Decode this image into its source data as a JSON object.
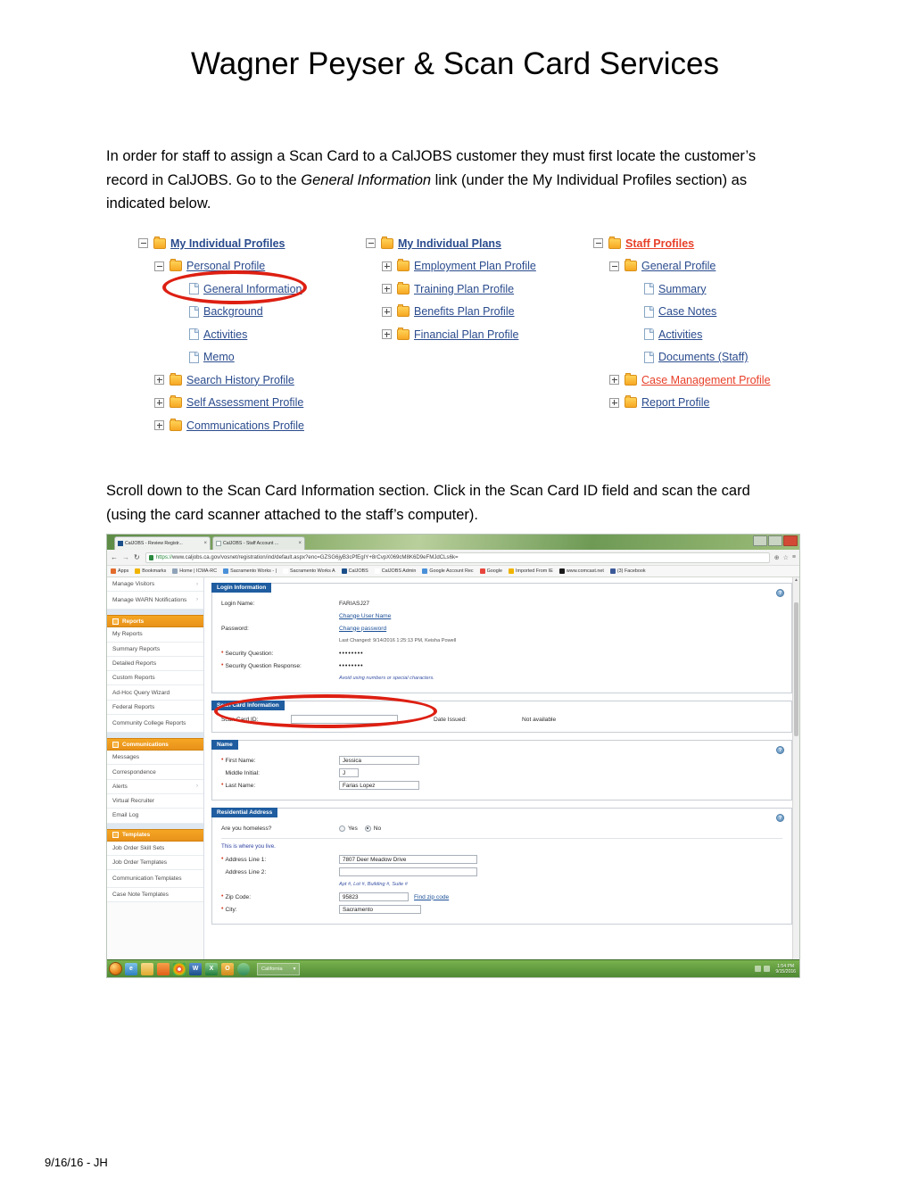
{
  "document": {
    "title": "Wagner Peyser & Scan Card Services",
    "footer": "9/16/16 - JH",
    "paragraph1_part1": "In order for staff to assign a Scan Card to a CalJOBS customer they must first locate the customer’s record in CalJOBS. Go to the ",
    "paragraph1_emphasis": "General Information",
    "paragraph1_part2": " link (under the My Individual Profiles section) as indicated below.",
    "paragraph2": "Scroll down to the Scan Card Information section. Click in the Scan Card ID field and scan the card (using the card scanner attached to the staff’s computer)."
  },
  "tree": {
    "columns": [
      {
        "root": "My Individual Profiles",
        "items": [
          {
            "label": "Personal Profile",
            "type": "folder",
            "toggle": "minus",
            "indent": 1
          },
          {
            "label": "General Information",
            "type": "doc",
            "toggle": "none",
            "indent": 2
          },
          {
            "label": "Background",
            "type": "doc",
            "toggle": "none",
            "indent": 2
          },
          {
            "label": "Activities",
            "type": "doc",
            "toggle": "none",
            "indent": 2
          },
          {
            "label": "Memo",
            "type": "doc",
            "toggle": "none",
            "indent": 2
          },
          {
            "label": "Search History Profile",
            "type": "folder",
            "toggle": "plus",
            "indent": 1
          },
          {
            "label": "Self Assessment Profile",
            "type": "folder",
            "toggle": "plus",
            "indent": 1
          },
          {
            "label": "Communications Profile",
            "type": "folder",
            "toggle": "plus",
            "indent": 1
          }
        ]
      },
      {
        "root": "My Individual Plans",
        "items": [
          {
            "label": "Employment Plan Profile",
            "type": "folder",
            "toggle": "plus",
            "indent": 1
          },
          {
            "label": "Training Plan Profile",
            "type": "folder",
            "toggle": "plus",
            "indent": 1
          },
          {
            "label": "Benefits Plan Profile",
            "type": "folder",
            "toggle": "plus",
            "indent": 1
          },
          {
            "label": "Financial Plan Profile",
            "type": "folder",
            "toggle": "plus",
            "indent": 1
          }
        ]
      },
      {
        "root": "Staff Profiles",
        "root_color": "#e8402a",
        "items": [
          {
            "label": "General Profile",
            "type": "folder",
            "toggle": "minus",
            "indent": 1
          },
          {
            "label": "Summary",
            "type": "doc",
            "toggle": "none",
            "indent": 2
          },
          {
            "label": "Case Notes",
            "type": "doc",
            "toggle": "none",
            "indent": 2
          },
          {
            "label": "Activities",
            "type": "doc",
            "toggle": "none",
            "indent": 2
          },
          {
            "label": "Documents (Staff)",
            "type": "doc",
            "toggle": "none",
            "indent": 2
          },
          {
            "label": "Case Management Profile",
            "type": "folder",
            "toggle": "plus",
            "indent": 1,
            "color": "#e8402a"
          },
          {
            "label": "Report Profile",
            "type": "folder",
            "toggle": "plus",
            "indent": 1
          }
        ]
      }
    ]
  },
  "browser": {
    "tabs": [
      {
        "title": "CalJOBS - Review Registr...",
        "close": "×"
      },
      {
        "title": "CalJOBS - Staff Account ...",
        "close": "×"
      }
    ],
    "window_controls": {
      "minimize": "–",
      "maximize": "□",
      "close": "×"
    },
    "back": "←",
    "forward": "→",
    "reload": "↻",
    "url_scheme": "https://",
    "url_rest": "www.caljobs.ca.gov/vosnet/registration/ind/default.aspx?enc=GZSG6jyB3cPfEgIY+8rCvpX069cM8K6D9eFMJdCLs6k=",
    "zoom_icon": "⊕",
    "star_icon": "☆",
    "menu_icon": "≡",
    "bookmarks": [
      {
        "label": "Apps",
        "color": "#e36b2c"
      },
      {
        "label": "Bookmarks",
        "color": "#f0b400"
      },
      {
        "label": "Home | ICMA-RC",
        "color": "#8fa3b8"
      },
      {
        "label": "Sacramento Works - |",
        "color": "#4a90d9"
      },
      {
        "label": "Sacramento Works A",
        "color": "#ffffff"
      },
      {
        "label": "CalJOBS",
        "color": "#1b4f8a"
      },
      {
        "label": "CalJOBS Admin",
        "color": "#ffffff"
      },
      {
        "label": "Google Account Rec",
        "color": "#4a90d9"
      },
      {
        "label": "Google",
        "color": "#e8453c"
      },
      {
        "label": "Imported From IE",
        "color": "#f0b400"
      },
      {
        "label": "www.comcast.net",
        "color": "#1a1a1a"
      },
      {
        "label": "(3) Facebook",
        "color": "#3b5998"
      }
    ]
  },
  "sidebar": {
    "groups": [
      {
        "header": null,
        "items": [
          {
            "label": "Manage Visitors",
            "arrow": "›"
          },
          {
            "label": "Manage WARN Notifications",
            "arrow": "›",
            "two_line": true
          }
        ]
      },
      {
        "header": "Reports",
        "items": [
          {
            "label": "My Reports"
          },
          {
            "label": "Summary Reports"
          },
          {
            "label": "Detailed Reports"
          },
          {
            "label": "Custom Reports"
          },
          {
            "label": "Ad-Hoc Query Wizard"
          },
          {
            "label": "Federal Reports"
          },
          {
            "label": "Community College Reports",
            "two_line": true
          }
        ]
      },
      {
        "header": "Communications",
        "items": [
          {
            "label": "Messages"
          },
          {
            "label": "Correspondence"
          },
          {
            "label": "Alerts",
            "arrow": "›"
          },
          {
            "label": "Virtual Recruiter"
          },
          {
            "label": "Email Log"
          }
        ]
      },
      {
        "header": "Templates",
        "items": [
          {
            "label": "Job Order Skill Sets"
          },
          {
            "label": "Job Order Templates"
          },
          {
            "label": "Communication Templates",
            "two_line": true
          },
          {
            "label": "Case Note Templates"
          }
        ]
      }
    ]
  },
  "form": {
    "login_panel": {
      "title": "Login Information",
      "help": "?",
      "login_name_label": "Login Name:",
      "login_name_value": "FARIASJ27",
      "change_user_name": "Change User Name",
      "password_label": "Password:",
      "change_password": "Change password",
      "last_changed": "Last Changed: 9/14/2016 1:25:13 PM, Keisha Powell",
      "security_question_label": "Security Question:",
      "security_question_value": "••••••••",
      "security_response_label": "Security Question Response:",
      "security_response_value": "••••••••",
      "security_hint": "Avoid using numbers or special characters."
    },
    "scan_card_panel": {
      "title": "Scan Card Information",
      "scan_card_id_label": "Scan Card ID:",
      "scan_card_id_value": "",
      "date_issued_label": "Date Issued:",
      "date_issued_value": "Not available"
    },
    "name_panel": {
      "title": "Name",
      "help": "?",
      "first_name_label": "First Name:",
      "first_name_value": "Jessica",
      "middle_initial_label": "Middle Initial:",
      "middle_initial_value": "J",
      "last_name_label": "Last Name:",
      "last_name_value": "Farias Lopez"
    },
    "address_panel": {
      "title": "Residential Address",
      "help": "?",
      "homeless_label": "Are you homeless?",
      "homeless_yes": "Yes",
      "homeless_no": "No",
      "homeless_selected": "No",
      "where_you_live": "This is where you live.",
      "address1_label": "Address Line 1:",
      "address1_value": "7807 Deer Meadow Drive",
      "address2_label": "Address Line 2:",
      "address2_value": "",
      "address2_hint": "Apt #, Lot #, Building #, Suite #",
      "zip_label": "Zip Code:",
      "zip_value": "95823",
      "find_zip": "Find zip code",
      "city_label": "City:",
      "city_value": "Sacramento"
    }
  },
  "taskbar": {
    "window_label": "California",
    "window_arrow": "▾",
    "icons": [
      "ie-icon",
      "explorer-icon",
      "media-icon",
      "chrome-icon",
      "word-icon",
      "excel-icon",
      "outlook-icon",
      "pdf-icon"
    ],
    "clock_time": "1:54 PM",
    "clock_date": "9/15/2016"
  }
}
